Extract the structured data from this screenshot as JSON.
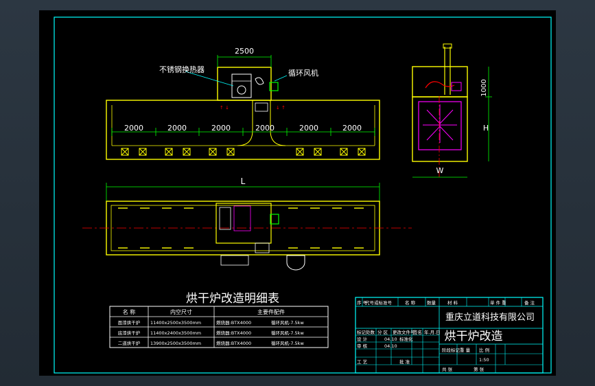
{
  "drawing": {
    "title_cn": "烘干炉改造明细表",
    "dims": {
      "heater_width": "2500",
      "segments": [
        "2000",
        "2000",
        "2000",
        "2000",
        "2000",
        "2000"
      ],
      "overall_length": "L",
      "side_height_top": "1000",
      "side_height_total": "H",
      "side_width": "W"
    },
    "labels": {
      "heat_exchanger": "不锈钢换热器",
      "circulation_fan": "循环风机"
    }
  },
  "spec_table": {
    "headers": [
      "名 称",
      "内空尺寸",
      "主要件配件"
    ],
    "rows": [
      [
        "面漆烘干炉",
        "11400x2500x3500mm",
        "燃烧器:BTX4000",
        "循环风机-7.5kw"
      ],
      [
        "底漆烘干炉",
        "11400x2400x3500mm",
        "燃烧器:BTX4000",
        "循环风机-7.5kw"
      ],
      [
        "二道烘干炉",
        "13900x2500x3500mm",
        "燃烧器:BTX4000",
        "循环风机-7.5kw"
      ]
    ]
  },
  "title_block": {
    "header_cells": [
      "序 号",
      "代号或标准号",
      "名 称",
      "数量",
      "材 料",
      "单 件 重",
      "备 注"
    ],
    "company": "重庆立道科技有限公司",
    "drawing_name": "烘干炉改造",
    "row_labels": [
      "标记处数",
      "分 区",
      "更改文件号",
      "签名",
      "年.月.日"
    ],
    "designer_row": [
      "设 计",
      "标准化"
    ],
    "check_row": [
      "审 核"
    ],
    "process_row": [
      "工 艺",
      "批 准"
    ],
    "stage_row": [
      "阶段标记",
      "重 量",
      "比 例"
    ],
    "scale": "1:50",
    "sheet_row": [
      "共 张",
      "第 张"
    ],
    "dates": [
      "04.10",
      "04.10"
    ]
  },
  "colors": {
    "frame": "#00ffff",
    "outline": "#ffff00",
    "dims": "#00ff00",
    "centerline": "#ff0000",
    "hatch": "#ff00ff",
    "text": "#ffffff"
  }
}
